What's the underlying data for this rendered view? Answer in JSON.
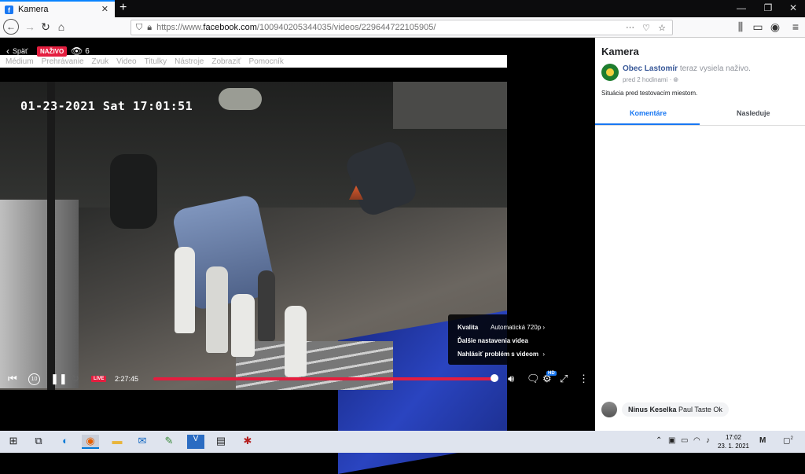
{
  "browser": {
    "tab_title": "Kamera",
    "new_tab": "+",
    "url_prefix": "https://www.",
    "url_domain": "facebook.com",
    "url_path": "/100940205344035/videos/229644722105905/",
    "menu_dots": "···"
  },
  "video": {
    "back_label": "Späť",
    "live_label": "NAŽIVO",
    "viewer_count": "6",
    "menu": [
      "Médium",
      "Prehrávanie",
      "Zvuk",
      "Video",
      "Titulky",
      "Nástroje",
      "Zobraziť",
      "Pomocník"
    ],
    "cam_timestamp": "01-23-2021 Sat 17:01:51",
    "settings_menu": {
      "quality_label": "Kvalita",
      "quality_value": "Automatická 720p",
      "more_settings": "Ďalšie nastavenia videa",
      "report_problem": "Nahlásiť problém s videom"
    },
    "controls": {
      "live_badge": "LIVE",
      "elapsed": "2:27:45",
      "progress": 1.0,
      "hd_badge": "HD"
    }
  },
  "sidebar": {
    "title": "Kamera",
    "author": "Obec Lastomír",
    "author_action": "teraz vysiela naživo.",
    "time_ago": "pred 2 hodinami",
    "separator": "·",
    "description": "Situácia pred testovacím miestom.",
    "tabs": [
      "Komentáre",
      "Nasleduje"
    ],
    "comment": {
      "author": "Ninus Keselka",
      "text": "Paul Taste Ok"
    }
  },
  "taskbar": {
    "time": "17:02",
    "date": "23. 1. 2021",
    "notifications": "2"
  },
  "colors": {
    "facebook_blue": "#1877f2",
    "live_red": "#e41e3f",
    "taskbar_bg": "#dfe4ee"
  }
}
